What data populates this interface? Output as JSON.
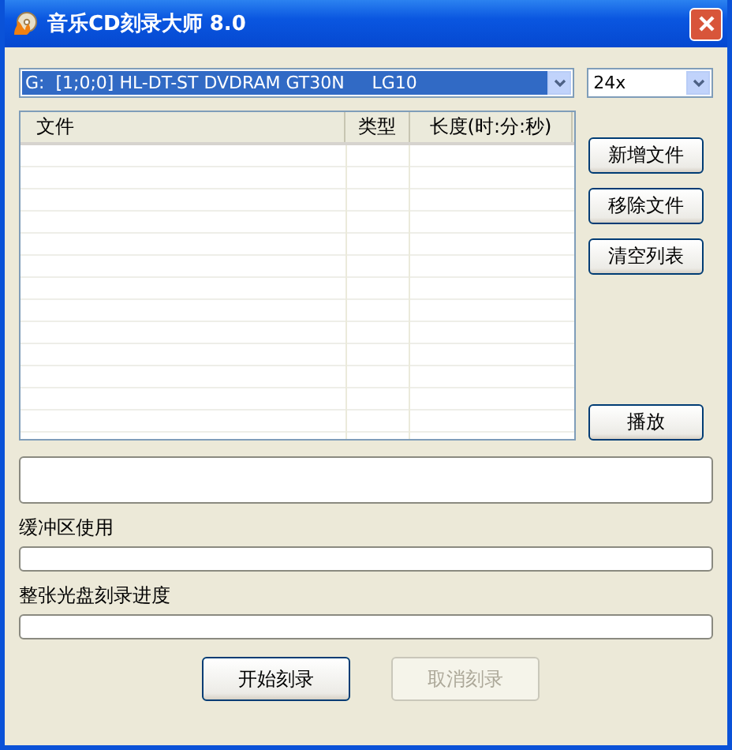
{
  "window": {
    "title": "音乐CD刻录大师 8.0"
  },
  "drive_select": {
    "value": "G:  [1;0;0] HL-DT-ST DVDRAM GT30N     LG10",
    "selected": true
  },
  "speed_select": {
    "value": "24x"
  },
  "file_list": {
    "columns": [
      "文件",
      "类型",
      "长度(时:分:秒)"
    ]
  },
  "side_buttons": [
    {
      "label": "新增文件"
    },
    {
      "label": "移除文件"
    },
    {
      "label": "清空列表"
    },
    {
      "label": "播放"
    }
  ],
  "buffer": {
    "label": "缓冲区使用",
    "level": 0
  },
  "disc_progress": {
    "label": "整张光盘刻录进度",
    "level": 0
  },
  "buttons": [
    {
      "label": "开始刻录",
      "disabled": false
    },
    {
      "label": "取消刻录",
      "disabled": true
    }
  ]
}
